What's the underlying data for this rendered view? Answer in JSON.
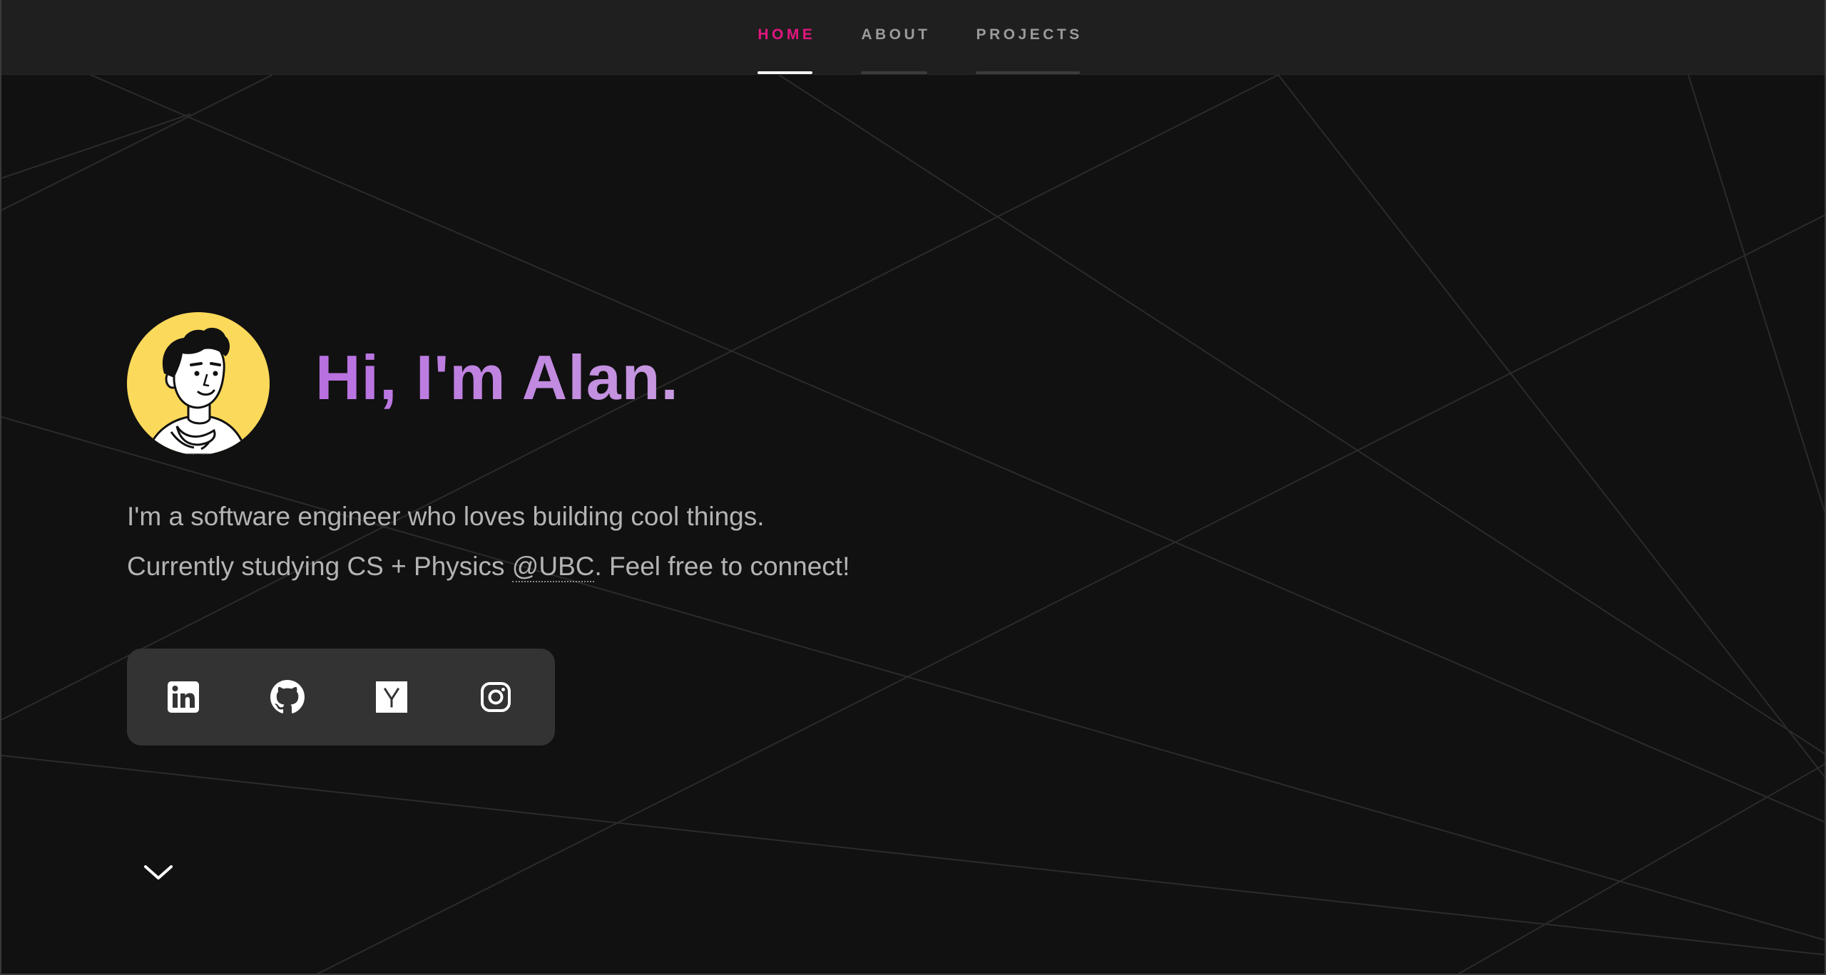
{
  "nav": {
    "items": [
      {
        "label": "HOME",
        "active": true
      },
      {
        "label": "ABOUT",
        "active": false
      },
      {
        "label": "PROJECTS",
        "active": false
      }
    ]
  },
  "hero": {
    "greeting": "Hi, I'm Alan.",
    "bio_line1": "I'm a software engineer who loves building cool things.",
    "bio_line2_before": "Currently studying CS + Physics ",
    "bio_link": "@UBC",
    "bio_line2_after": ". Feel free to connect!"
  },
  "socials": [
    {
      "icon": "linkedin-icon"
    },
    {
      "icon": "github-icon"
    },
    {
      "icon": "ycombinator-icon",
      "glyph": "Y"
    },
    {
      "icon": "instagram-icon"
    }
  ],
  "colors": {
    "background": "#111111",
    "nav_background": "#1f1f1f",
    "nav_active": "#e3167f",
    "nav_inactive": "#9b9b9b",
    "greeting_gradient_start": "#b86fe0",
    "greeting_gradient_end": "#c79ae0",
    "avatar_background": "#fbd95a",
    "socials_background": "#333333",
    "body_text": "#b4b4b4"
  },
  "scroll_indicator": {
    "icon": "chevron-down-icon"
  }
}
